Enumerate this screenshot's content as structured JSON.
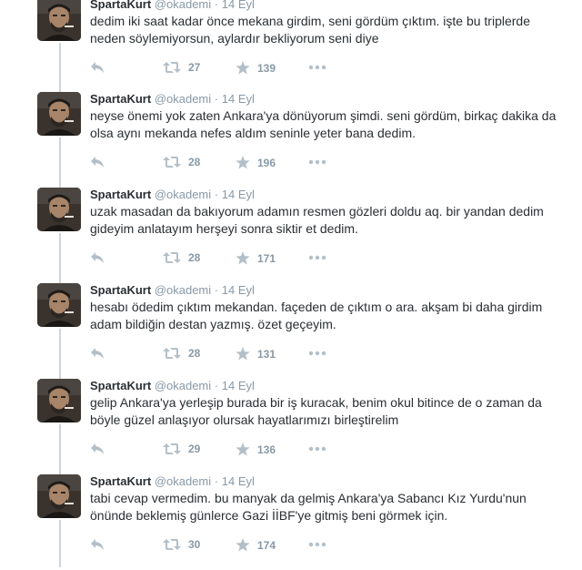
{
  "colors": {
    "text": "#292f33",
    "muted": "#8899a6",
    "thread_line": "#ccd6dd"
  },
  "icons": {
    "reply": "reply-icon",
    "retweet": "retweet-icon",
    "favorite": "star-icon",
    "more": "more-dots-icon"
  },
  "tweets": [
    {
      "name": "SpartaKurt",
      "handle": "@okademi",
      "sep": "·",
      "date": "14 Eyl",
      "text": "dedim iki saat kadar önce mekana girdim, seni gördüm çıktım. işte bu triplerde neden söylemiyorsun, aylardır bekliyorum seni diye",
      "retweets": "27",
      "favorites": "139"
    },
    {
      "name": "SpartaKurt",
      "handle": "@okademi",
      "sep": "·",
      "date": "14 Eyl",
      "text": "neyse önemi yok zaten Ankara'ya dönüyorum şimdi. seni gördüm, birkaç dakika da olsa aynı mekanda nefes aldım seninle yeter bana dedim.",
      "retweets": "28",
      "favorites": "196"
    },
    {
      "name": "SpartaKurt",
      "handle": "@okademi",
      "sep": "·",
      "date": "14 Eyl",
      "text": "uzak masadan da bakıyorum adamın resmen gözleri doldu aq. bir yandan dedim gideyim anlatayım herşeyi sonra siktir et dedim.",
      "retweets": "28",
      "favorites": "171"
    },
    {
      "name": "SpartaKurt",
      "handle": "@okademi",
      "sep": "·",
      "date": "14 Eyl",
      "text": "hesabı ödedim çıktım mekandan. façeden de çıktım o ara. akşam bi daha girdim adam bildiğin destan yazmış. özet geçeyim.",
      "retweets": "28",
      "favorites": "131"
    },
    {
      "name": "SpartaKurt",
      "handle": "@okademi",
      "sep": "·",
      "date": "14 Eyl",
      "text": "gelip Ankara'ya yerleşip burada bir iş kuracak, benim okul bitince de o zaman da böyle güzel anlaşıyor olursak hayatlarımızı birleştirelim",
      "retweets": "29",
      "favorites": "136"
    },
    {
      "name": "SpartaKurt",
      "handle": "@okademi",
      "sep": "·",
      "date": "14 Eyl",
      "text": "tabi cevap vermedim. bu manyak da gelmiş Ankara'ya Sabancı Kız Yurdu'nun önünde beklemiş günlerce Gazi İİBF'ye gitmiş beni görmek için.",
      "retweets": "30",
      "favorites": "174"
    }
  ]
}
